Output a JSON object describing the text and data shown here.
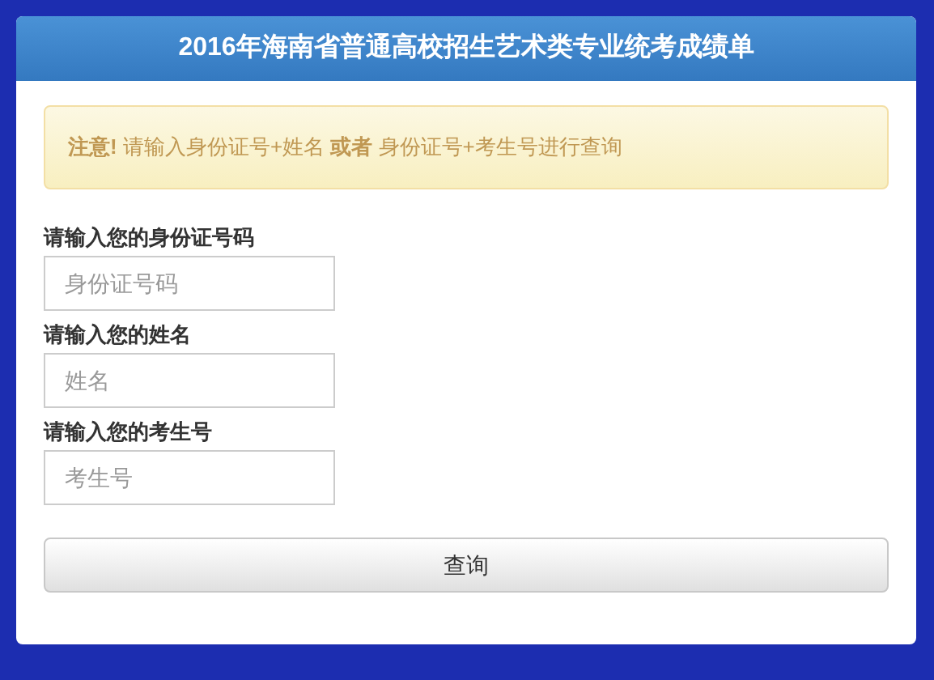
{
  "panel": {
    "title": "2016年海南省普通高校招生艺术类专业统考成绩单"
  },
  "notice": {
    "text": "**注意!** 请输入身份证号+姓名 **或者** 身份证号+考生号进行查询"
  },
  "fields": [
    {
      "label": "请输入您的身份证号码",
      "placeholder": "身份证号码"
    },
    {
      "label": "请输入您的姓名",
      "placeholder": "姓名"
    },
    {
      "label": "请输入您的考生号",
      "placeholder": "考生号"
    }
  ],
  "submit_button": {
    "label": "查询"
  }
}
